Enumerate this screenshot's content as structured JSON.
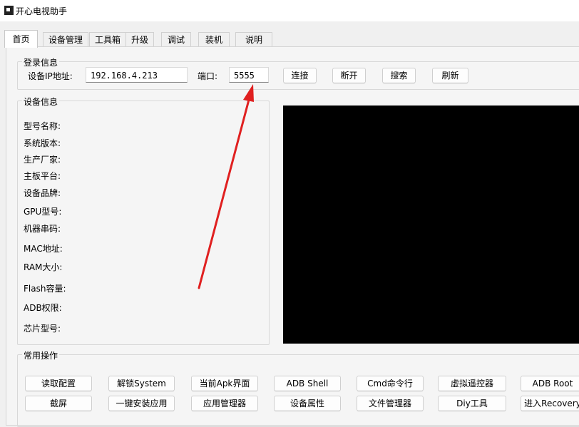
{
  "window": {
    "title": "开心电视助手"
  },
  "tabs": [
    {
      "label": "首页"
    },
    {
      "label": "设备管理"
    },
    {
      "label": "工具箱"
    },
    {
      "label": "升级"
    },
    {
      "label": "调试"
    },
    {
      "label": "装机"
    },
    {
      "label": "说明"
    }
  ],
  "login": {
    "group_title": "登录信息",
    "ip_label": "设备IP地址:",
    "ip_value": "192.168.4.213",
    "port_label": "端口:",
    "port_value": "5555",
    "connect": "连接",
    "disconnect": "断开",
    "search": "搜索",
    "refresh": "刷新"
  },
  "device_info": {
    "group_title": "设备信息",
    "fields": [
      {
        "label": "型号名称:"
      },
      {
        "label": "系统版本:"
      },
      {
        "label": "生产厂家:"
      },
      {
        "label": "主板平台:"
      },
      {
        "label": "设备品牌:"
      },
      {
        "label": "GPU型号:"
      },
      {
        "label": "机器串码:"
      },
      {
        "label": "MAC地址:"
      },
      {
        "label": "RAM大小:"
      },
      {
        "label": "Flash容量:"
      },
      {
        "label": "ADB权限:"
      },
      {
        "label": "芯片型号:"
      }
    ]
  },
  "common_ops": {
    "group_title": "常用操作",
    "row1": [
      "读取配置",
      "解锁System",
      "当前Apk界面",
      "ADB Shell",
      "Cmd命令行",
      "虚拟遥控器",
      "ADB Root"
    ],
    "row2": [
      "截屏",
      "一键安装应用",
      "应用管理器",
      "设备属性",
      "文件管理器",
      "Diy工具",
      "进入Recovery"
    ]
  },
  "annotation": {
    "arrow_color": "#e02020"
  }
}
